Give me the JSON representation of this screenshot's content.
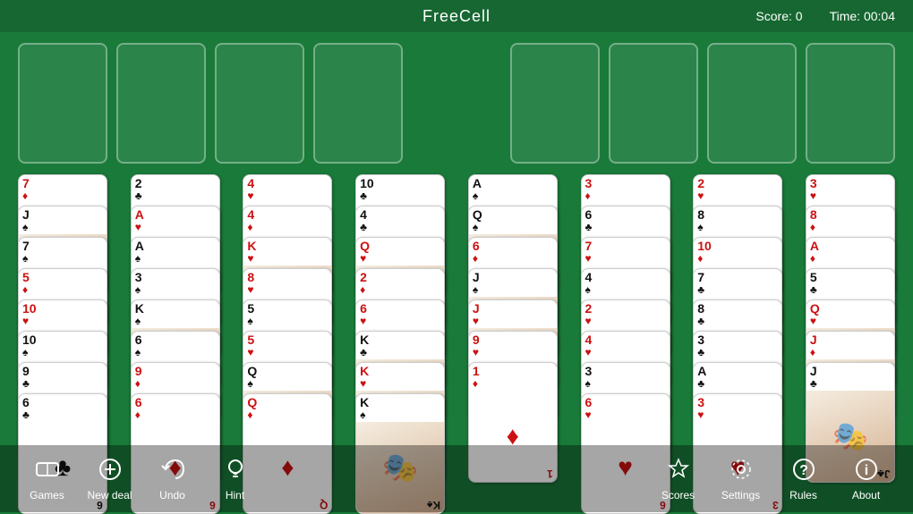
{
  "header": {
    "title": "FreeCell",
    "score_label": "Score:",
    "score_value": "0",
    "time_label": "Time:",
    "time_value": "00:04"
  },
  "freecells": [
    {
      "id": "fc1",
      "empty": true
    },
    {
      "id": "fc2",
      "empty": true
    },
    {
      "id": "fc3",
      "empty": true
    },
    {
      "id": "fc4",
      "empty": true
    }
  ],
  "foundations": [
    {
      "id": "f1",
      "empty": true
    },
    {
      "id": "f2",
      "empty": true
    },
    {
      "id": "f3",
      "empty": true
    },
    {
      "id": "f4",
      "empty": true
    }
  ],
  "columns": [
    {
      "id": "col1",
      "cards": [
        {
          "rank": "7",
          "suit": "♦",
          "color": "red",
          "face": false
        },
        {
          "rank": "J",
          "suit": "♠",
          "color": "black",
          "face": true
        },
        {
          "rank": "7",
          "suit": "♠",
          "color": "black",
          "face": false
        },
        {
          "rank": "5",
          "suit": "♦",
          "color": "red",
          "face": false
        },
        {
          "rank": "10",
          "suit": "♥",
          "color": "red",
          "face": false
        },
        {
          "rank": "10",
          "suit": "♠",
          "color": "black",
          "face": false
        },
        {
          "rank": "9",
          "suit": "♣",
          "color": "black",
          "face": false
        },
        {
          "rank": "6",
          "suit": "♣",
          "color": "black",
          "face": false
        }
      ]
    },
    {
      "id": "col2",
      "cards": [
        {
          "rank": "2",
          "suit": "♣",
          "color": "black",
          "face": false
        },
        {
          "rank": "A",
          "suit": "♥",
          "color": "red",
          "face": false
        },
        {
          "rank": "A",
          "suit": "♠",
          "color": "black",
          "face": false
        },
        {
          "rank": "3",
          "suit": "♠",
          "color": "black",
          "face": false
        },
        {
          "rank": "K",
          "suit": "♠",
          "color": "black",
          "face": true
        },
        {
          "rank": "6",
          "suit": "♠",
          "color": "black",
          "face": false
        },
        {
          "rank": "9",
          "suit": "♦",
          "color": "red",
          "face": false
        },
        {
          "rank": "6",
          "suit": "♦",
          "color": "red",
          "face": false
        }
      ]
    },
    {
      "id": "col3",
      "cards": [
        {
          "rank": "4",
          "suit": "♥",
          "color": "red",
          "face": false
        },
        {
          "rank": "4",
          "suit": "♦",
          "color": "red",
          "face": false
        },
        {
          "rank": "K",
          "suit": "♥",
          "color": "red",
          "face": true
        },
        {
          "rank": "8",
          "suit": "♥",
          "color": "red",
          "face": false
        },
        {
          "rank": "5",
          "suit": "♠",
          "color": "black",
          "face": false
        },
        {
          "rank": "5",
          "suit": "♥",
          "color": "red",
          "face": false
        },
        {
          "rank": "Q",
          "suit": "♠",
          "color": "black",
          "face": true
        },
        {
          "rank": "Q",
          "suit": "♦",
          "color": "red",
          "face": false
        }
      ]
    },
    {
      "id": "col4",
      "cards": [
        {
          "rank": "10",
          "suit": "♣",
          "color": "black",
          "face": false
        },
        {
          "rank": "4",
          "suit": "♣",
          "color": "black",
          "face": false
        },
        {
          "rank": "Q",
          "suit": "♥",
          "color": "red",
          "face": true
        },
        {
          "rank": "2",
          "suit": "♦",
          "color": "red",
          "face": false
        },
        {
          "rank": "6",
          "suit": "♥",
          "color": "red",
          "face": false
        },
        {
          "rank": "K",
          "suit": "♣",
          "color": "black",
          "face": true
        },
        {
          "rank": "K",
          "suit": "♥",
          "color": "red",
          "face": true
        },
        {
          "rank": "K",
          "suit": "♠",
          "color": "black",
          "face": true
        }
      ]
    },
    {
      "id": "col5",
      "cards": [
        {
          "rank": "A",
          "suit": "♠",
          "color": "black",
          "face": false
        },
        {
          "rank": "Q",
          "suit": "♠",
          "color": "black",
          "face": true
        },
        {
          "rank": "6",
          "suit": "♦",
          "color": "red",
          "face": false
        },
        {
          "rank": "J",
          "suit": "♠",
          "color": "black",
          "face": true
        },
        {
          "rank": "J",
          "suit": "♥",
          "color": "red",
          "face": true
        },
        {
          "rank": "9",
          "suit": "♥",
          "color": "red",
          "face": false
        },
        {
          "rank": "1",
          "suit": "♦",
          "color": "red",
          "face": false
        }
      ]
    },
    {
      "id": "col6",
      "cards": [
        {
          "rank": "3",
          "suit": "♦",
          "color": "red",
          "face": false
        },
        {
          "rank": "6",
          "suit": "♣",
          "color": "black",
          "face": false
        },
        {
          "rank": "7",
          "suit": "♥",
          "color": "red",
          "face": false
        },
        {
          "rank": "4",
          "suit": "♠",
          "color": "black",
          "face": false
        },
        {
          "rank": "2",
          "suit": "♥",
          "color": "red",
          "face": false
        },
        {
          "rank": "4",
          "suit": "♥",
          "color": "red",
          "face": false
        },
        {
          "rank": "3",
          "suit": "♠",
          "color": "black",
          "face": false
        },
        {
          "rank": "6",
          "suit": "♥",
          "color": "red",
          "face": false
        }
      ]
    },
    {
      "id": "col7",
      "cards": [
        {
          "rank": "2",
          "suit": "♥",
          "color": "red",
          "face": false
        },
        {
          "rank": "8",
          "suit": "♠",
          "color": "black",
          "face": false
        },
        {
          "rank": "10",
          "suit": "♦",
          "color": "red",
          "face": false
        },
        {
          "rank": "7",
          "suit": "♣",
          "color": "black",
          "face": false
        },
        {
          "rank": "8",
          "suit": "♣",
          "color": "black",
          "face": false
        },
        {
          "rank": "3",
          "suit": "♣",
          "color": "black",
          "face": false
        },
        {
          "rank": "A",
          "suit": "♣",
          "color": "black",
          "face": false
        },
        {
          "rank": "3",
          "suit": "♥",
          "color": "red",
          "face": false
        }
      ]
    },
    {
      "id": "col8",
      "cards": [
        {
          "rank": "3",
          "suit": "♥",
          "color": "red",
          "face": false
        },
        {
          "rank": "8",
          "suit": "♦",
          "color": "red",
          "face": false
        },
        {
          "rank": "A",
          "suit": "♦",
          "color": "red",
          "face": false
        },
        {
          "rank": "5",
          "suit": "♣",
          "color": "black",
          "face": false
        },
        {
          "rank": "Q",
          "suit": "♥",
          "color": "red",
          "face": true
        },
        {
          "rank": "J",
          "suit": "♦",
          "color": "red",
          "face": true
        },
        {
          "rank": "J",
          "suit": "♣",
          "color": "black",
          "face": true
        }
      ]
    }
  ],
  "toolbar": {
    "left_buttons": [
      {
        "id": "games",
        "label": "Games",
        "icon": "🎮"
      },
      {
        "id": "new-deal",
        "label": "New deal",
        "icon": "➕"
      },
      {
        "id": "undo",
        "label": "Undo",
        "icon": "↩"
      },
      {
        "id": "hint",
        "label": "Hint",
        "icon": "💡"
      }
    ],
    "right_buttons": [
      {
        "id": "scores",
        "label": "Scores",
        "icon": "👑"
      },
      {
        "id": "settings",
        "label": "Settings",
        "icon": "⚙"
      },
      {
        "id": "rules",
        "label": "Rules",
        "icon": "❓"
      },
      {
        "id": "about",
        "label": "About",
        "icon": "ℹ"
      }
    ]
  }
}
